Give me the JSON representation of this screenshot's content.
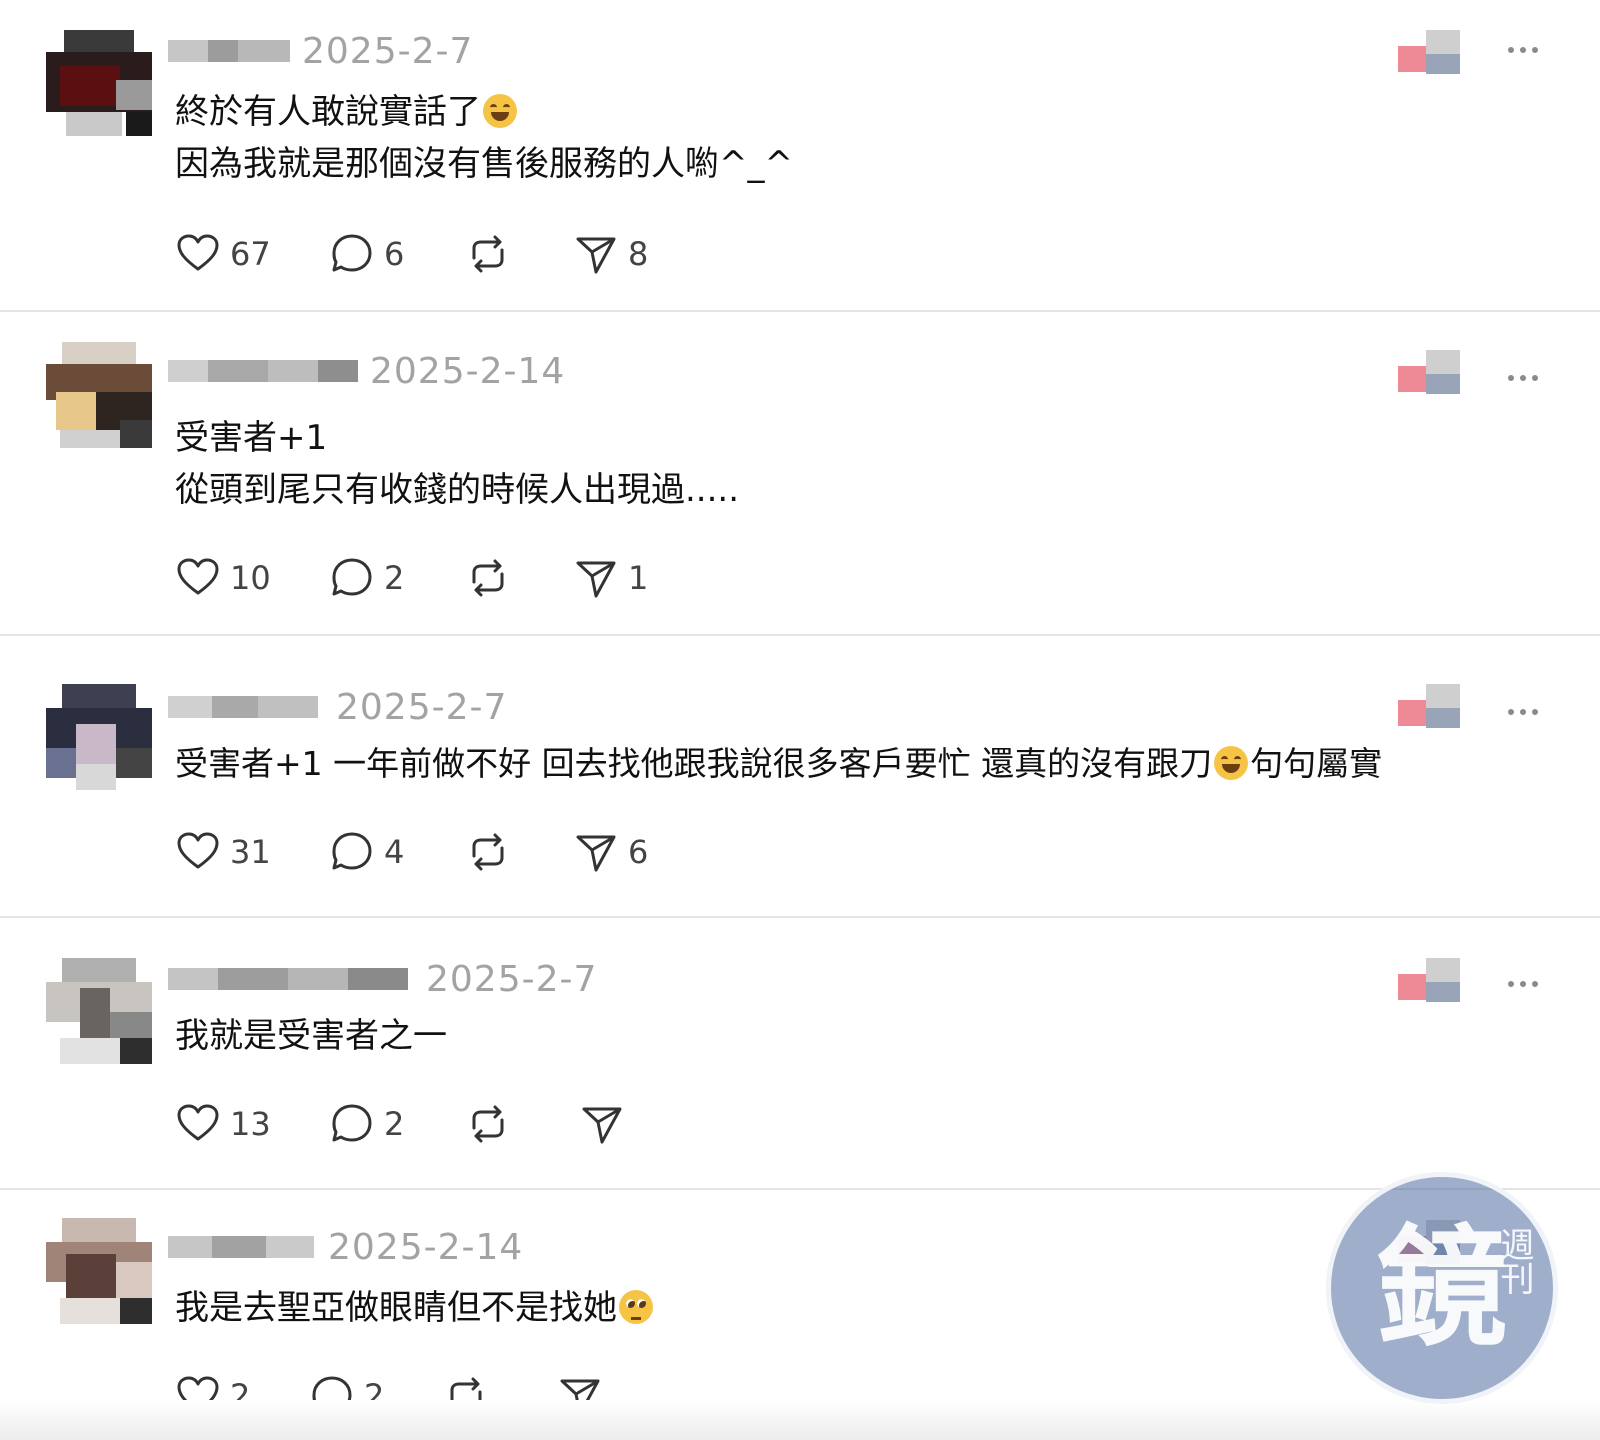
{
  "posts": [
    {
      "date": "2025-2-7",
      "lines": [
        "終於有人敢說實話了",
        "因為我就是那個沒有售後服務的人喲^_^"
      ],
      "line1_emoji": "laughing-tears-emoji",
      "likes": "67",
      "replies": "6",
      "reposts": "",
      "shares": "8"
    },
    {
      "date": "2025-2-14",
      "lines": [
        "受害者+1",
        "從頭到尾只有收錢的時候人出現過....."
      ],
      "likes": "10",
      "replies": "2",
      "reposts": "",
      "shares": "1"
    },
    {
      "date": "2025-2-7",
      "text_a": "受害者+1 一年前做不好 回去找他跟我說很多客戶要忙 還真的沒有跟刀",
      "text_b": "句句屬實",
      "mid_emoji": "grinning-squint-emoji",
      "likes": "31",
      "replies": "4",
      "reposts": "",
      "shares": "6"
    },
    {
      "date": "2025-2-7",
      "lines": [
        "我就是受害者之一"
      ],
      "likes": "13",
      "replies": "2",
      "reposts": "",
      "shares": ""
    },
    {
      "date": "2025-2-14",
      "lines": [
        "我是去聖亞做眼睛但不是找她"
      ],
      "line1_emoji": "pleading-face-emoji",
      "likes": "2",
      "replies": "2",
      "reposts": "",
      "shares": ""
    }
  ],
  "icons": {
    "like": "heart-icon",
    "reply": "comment-bubble-icon",
    "repost": "repost-arrows-icon",
    "share": "paper-plane-icon",
    "more": "more-dots-icon"
  },
  "colors": {
    "date": "#a3a3a3",
    "divider": "#e4e4e4",
    "text": "#111111",
    "count": "#444444"
  },
  "watermark": {
    "main": "鏡",
    "side": "週刊"
  }
}
